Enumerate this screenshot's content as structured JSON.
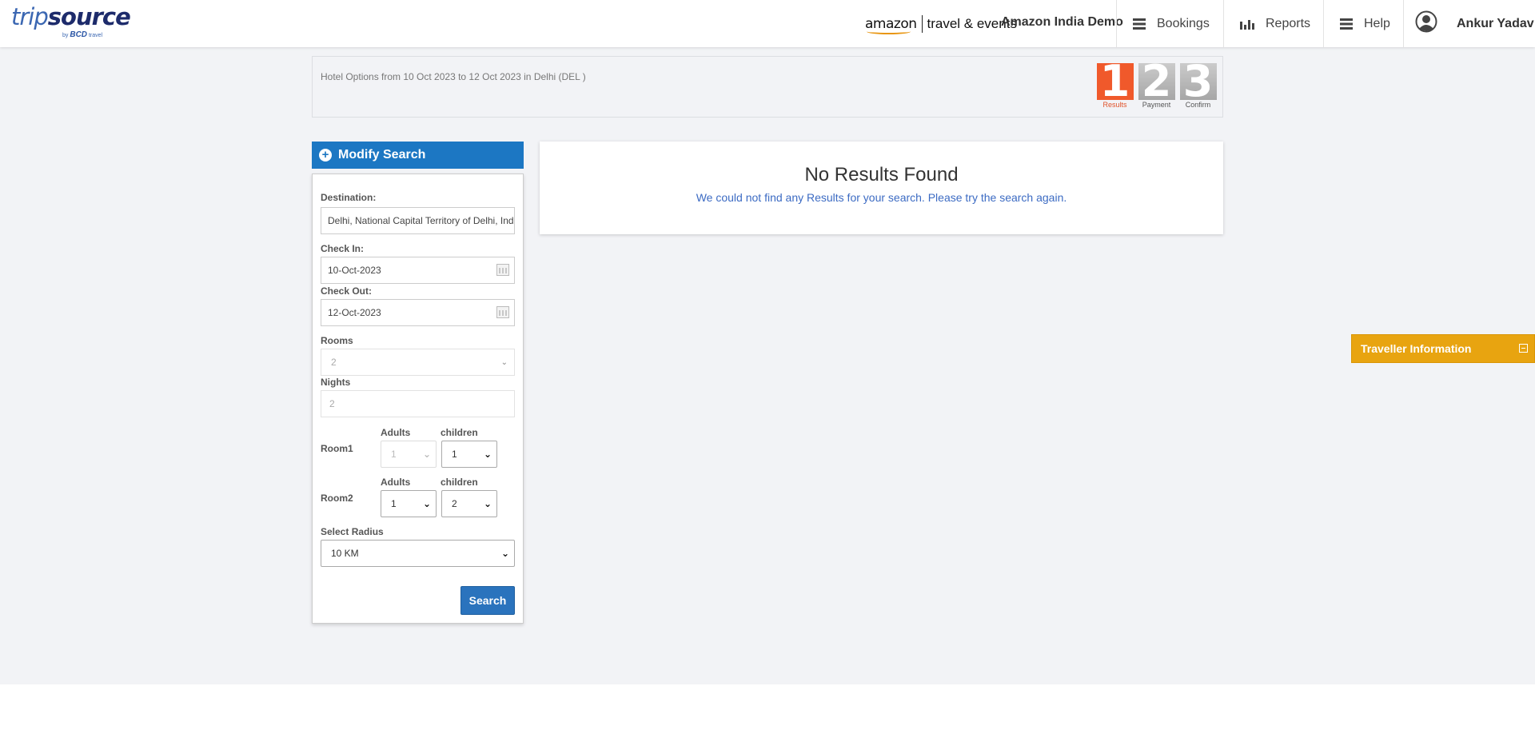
{
  "header": {
    "logo_main_1": "trip",
    "logo_main_2": "source",
    "logo_sub_by": "by",
    "logo_sub_brand": "BCD",
    "logo_sub_travel": "travel",
    "partner_amazon": "amazon",
    "partner_te": "travel & events",
    "company": "Amazon India Demo",
    "nav": {
      "bookings": "Bookings",
      "reports": "Reports",
      "help": "Help"
    },
    "user_name": "Ankur Yadav"
  },
  "infobar": {
    "text": "Hotel Options from  10 Oct 2023 to 12 Oct 2023 in Delhi (DEL )",
    "steps": [
      {
        "num": "1",
        "label": "Results"
      },
      {
        "num": "2",
        "label": "Payment"
      },
      {
        "num": "3",
        "label": "Confirm"
      }
    ]
  },
  "modify": {
    "title": "Modify Search",
    "destination_label": "Destination:",
    "destination_value": "Delhi, National Capital Territory of Delhi, India",
    "checkin_label": "Check In:",
    "checkin_value": "10-Oct-2023",
    "checkout_label": "Check Out:",
    "checkout_value": "12-Oct-2023",
    "rooms_label": "Rooms",
    "rooms_value": "2",
    "nights_label": "Nights",
    "nights_value": "2",
    "room1": {
      "label": "Room1",
      "adults_label": "Adults",
      "children_label": "children",
      "adults": "1",
      "children": "1"
    },
    "room2": {
      "label": "Room2",
      "adults_label": "Adults",
      "children_label": "children",
      "adults": "1",
      "children": "2"
    },
    "radius_label": "Select Radius",
    "radius_value": "10 KM",
    "search_button": "Search"
  },
  "results": {
    "title": "No Results Found",
    "message": "We could not find any Results for your search. Please try the search again."
  },
  "traveller": {
    "label": "Traveller Information"
  },
  "colors": {
    "primary": "#1c77c3",
    "step_active": "#f0592b",
    "traveller": "#e8a410"
  }
}
